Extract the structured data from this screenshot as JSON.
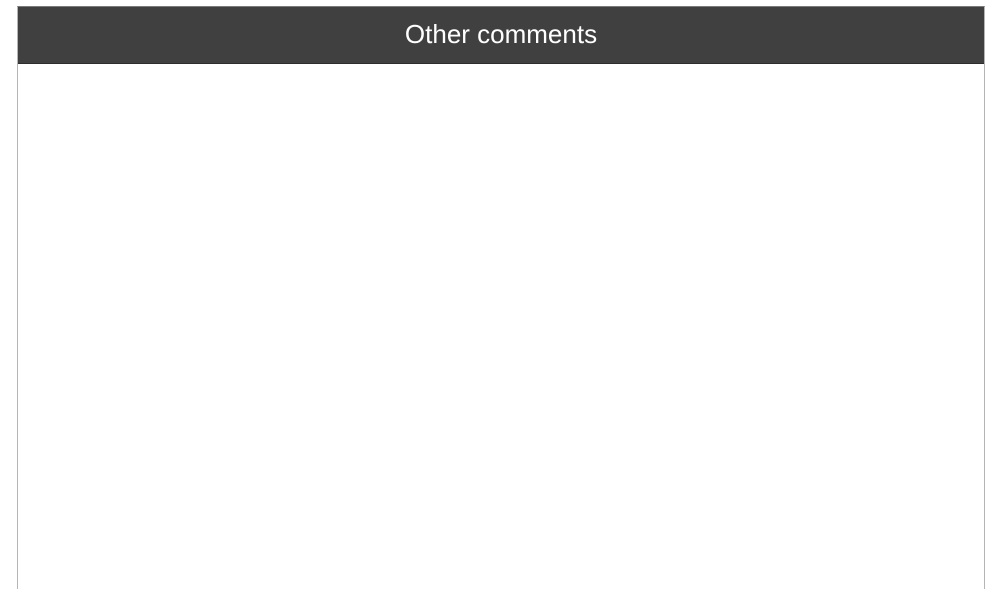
{
  "panel": {
    "title": "Other comments",
    "comments_value": "",
    "colors": {
      "header_background": "#404040",
      "header_text": "#ffffff",
      "body_background": "#ffffff",
      "border": "#b5b5b5"
    }
  }
}
